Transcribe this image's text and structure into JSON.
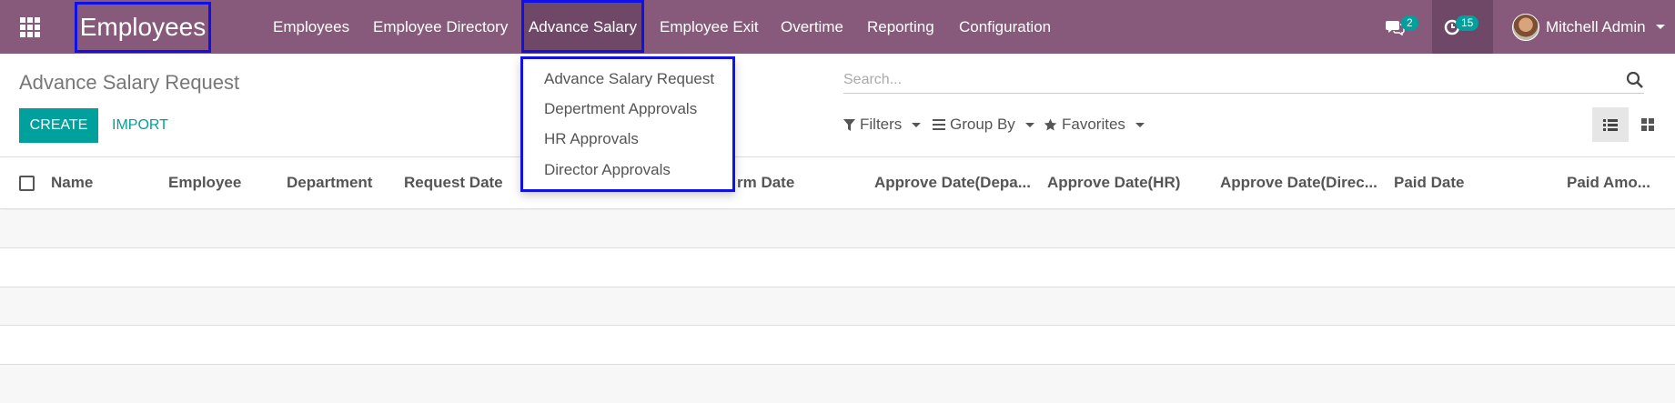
{
  "navbar": {
    "brand": "Employees",
    "menu": [
      {
        "label": "Employees"
      },
      {
        "label": "Employee Directory"
      },
      {
        "label": "Advance Salary"
      },
      {
        "label": "Employee Exit"
      },
      {
        "label": "Overtime"
      },
      {
        "label": "Reporting"
      },
      {
        "label": "Configuration"
      }
    ],
    "messages_count": "2",
    "activities_count": "15",
    "user_name": "Mitchell Admin"
  },
  "dropdown": {
    "items": [
      {
        "label": "Advance Salary Request"
      },
      {
        "label": "Depertment Approvals"
      },
      {
        "label": "HR Approvals"
      },
      {
        "label": "Director Approvals"
      }
    ]
  },
  "page": {
    "title": "Advance Salary Request",
    "create_label": "CREATE",
    "import_label": "IMPORT"
  },
  "search": {
    "placeholder": "Search..."
  },
  "toolbar": {
    "filters_label": "Filters",
    "groupby_label": "Group By",
    "favorites_label": "Favorites"
  },
  "table": {
    "columns": [
      "Name",
      "Employee",
      "Department",
      "Request Date",
      "rm Date",
      "Approve Date(Depa...",
      "Approve Date(HR)",
      "Approve Date(Direc...",
      "Paid Date",
      "Paid Amo..."
    ]
  },
  "colors": {
    "navbar": "#875a7b",
    "accent": "#00a09d",
    "highlight_box": "#1010e8"
  }
}
